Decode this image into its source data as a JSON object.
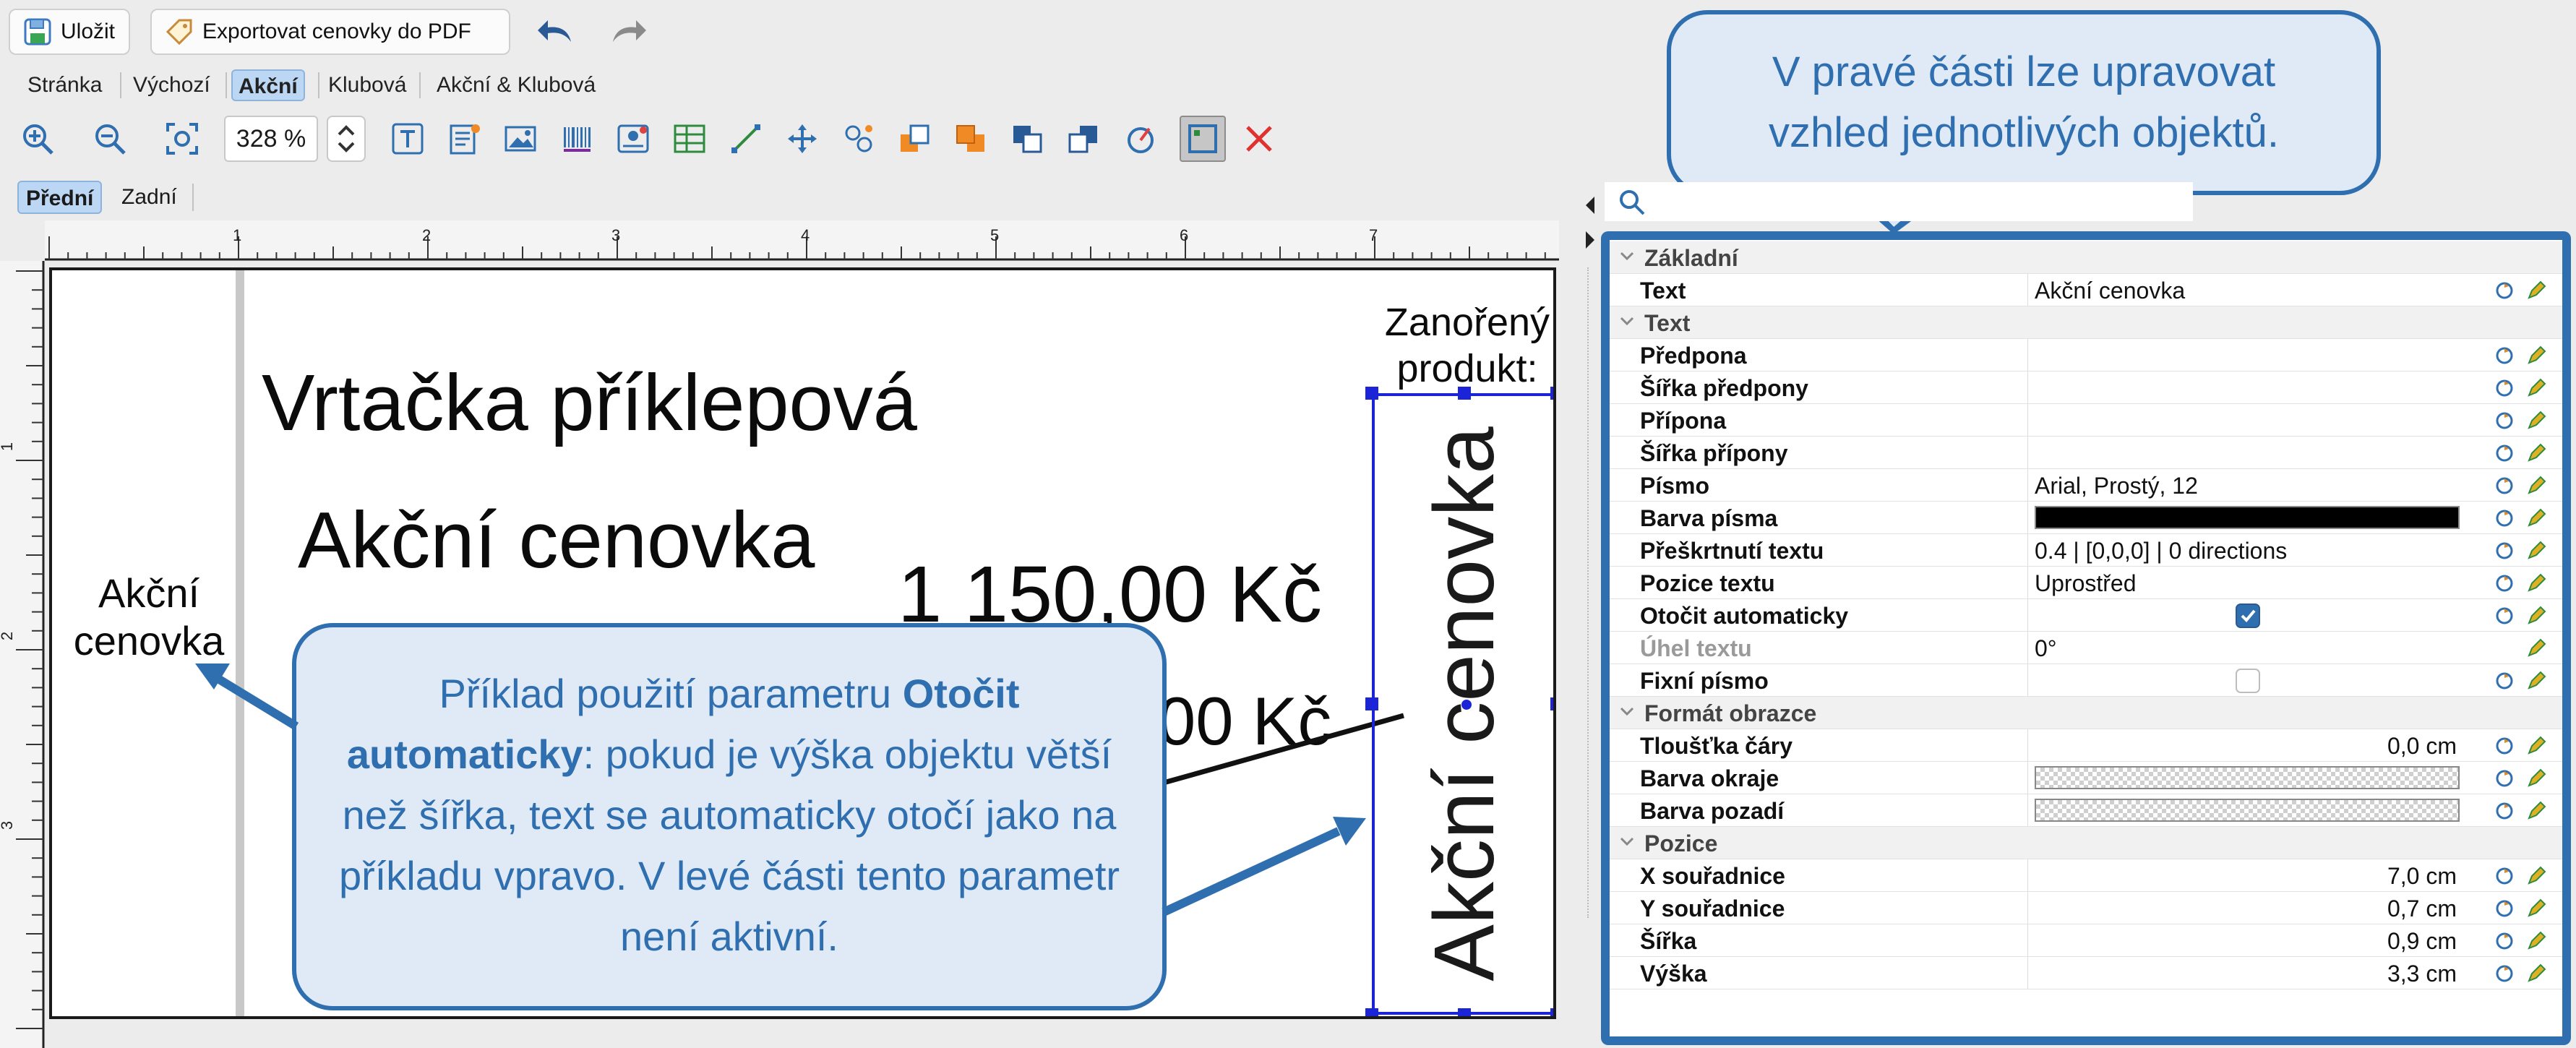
{
  "toolbar": {
    "save_label": "Uložit",
    "export_label": "Exportovat cenovky do PDF",
    "zoom_value": "328 %"
  },
  "template_tabs": [
    "Stránka",
    "Výchozí",
    "Akční",
    "Klubová",
    "Akční & Klubová"
  ],
  "active_template_tab": "Akční",
  "side_tabs": [
    "Přední",
    "Zadní"
  ],
  "active_side_tab": "Přední",
  "ruler": {
    "horizontal_ticks": [
      "1",
      "2",
      "3",
      "4",
      "5",
      "6",
      "7"
    ],
    "vertical_ticks": [
      "1",
      "2",
      "3"
    ]
  },
  "label": {
    "product_name": "Vrtačka příklepová",
    "promo_text": "Akční cenovka",
    "price": "1 150,00 Kč",
    "old_price_visible": "00 Kč",
    "left_text_line1": "Akční",
    "left_text_line2": "cenovka",
    "nested_line1": "Zanořený",
    "nested_line2": "produkt:",
    "rotated_text": "Akční cenovka"
  },
  "callouts": {
    "top_right": {
      "line1": "V pravé části lze upravovat",
      "line2": "vzhled jednotlivých objektů."
    },
    "bottom": {
      "intro": "Příklad použití parametru ",
      "bold": "Otočit automaticky",
      "rest": ": pokud je výška objektu větší než šířka, text se automaticky otočí jako na příkladu vpravo. V levé části tento parametr není aktivní."
    }
  },
  "properties": {
    "sections": [
      {
        "name": "Základní",
        "rows": [
          {
            "label": "Text",
            "value": "Akční cenovka",
            "kind": "text"
          }
        ]
      },
      {
        "name": "Text",
        "rows": [
          {
            "label": "Předpona",
            "value": "",
            "kind": "text"
          },
          {
            "label": "Šířka předpony",
            "value": "",
            "kind": "text"
          },
          {
            "label": "Přípona",
            "value": "",
            "kind": "text"
          },
          {
            "label": "Šířka přípony",
            "value": "",
            "kind": "text"
          },
          {
            "label": "Písmo",
            "value": "Arial, Prostý, 12",
            "kind": "text"
          },
          {
            "label": "Barva písma",
            "value": "#000000",
            "kind": "color"
          },
          {
            "label": "Přeškrtnutí textu",
            "value": "0.4 | [0,0,0] | 0 directions",
            "kind": "text"
          },
          {
            "label": "Pozice textu",
            "value": "Uprostřed",
            "kind": "text"
          },
          {
            "label": "Otočit automaticky",
            "value": "true",
            "kind": "checkbox"
          },
          {
            "label": "Úhel textu",
            "value": "0°",
            "kind": "text",
            "disabled": true
          },
          {
            "label": "Fixní písmo",
            "value": "false",
            "kind": "checkbox"
          }
        ]
      },
      {
        "name": "Formát obrazce",
        "rows": [
          {
            "label": "Tloušťka čáry",
            "value": "0,0 cm",
            "kind": "number"
          },
          {
            "label": "Barva okraje",
            "value": "transparent",
            "kind": "transparent"
          },
          {
            "label": "Barva pozadí",
            "value": "transparent",
            "kind": "transparent"
          }
        ]
      },
      {
        "name": "Pozice",
        "rows": [
          {
            "label": "X souřadnice",
            "value": "7,0 cm",
            "kind": "number"
          },
          {
            "label": "Y souřadnice",
            "value": "0,7 cm",
            "kind": "number"
          },
          {
            "label": "Šířka",
            "value": "0,9 cm",
            "kind": "number"
          },
          {
            "label": "Výška",
            "value": "3,3 cm",
            "kind": "number"
          }
        ]
      }
    ]
  },
  "colors": {
    "accent": "#2f6fb0",
    "selection": "#1c24d8",
    "callout_fill": "#dfeaf6",
    "tab_active": "#bcd7f3"
  }
}
